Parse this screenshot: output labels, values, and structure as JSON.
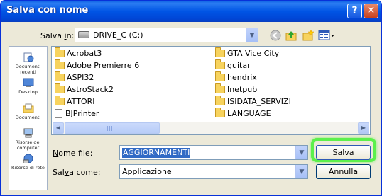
{
  "window": {
    "title": "Salva con nome"
  },
  "title_buttons": {
    "help": "?",
    "close": "✕"
  },
  "save_in": {
    "label": "Salva in:",
    "drive": "DRIVE_C (C:)"
  },
  "places": [
    {
      "label": "Documenti recenti",
      "icon": "recent-documents-icon"
    },
    {
      "label": "Desktop",
      "icon": "desktop-icon"
    },
    {
      "label": "Documenti",
      "icon": "documents-icon"
    },
    {
      "label": "Risorse del computer",
      "icon": "my-computer-icon"
    },
    {
      "label": "Risorse di rete",
      "icon": "network-icon"
    }
  ],
  "files": {
    "column1": [
      "Acrobat3",
      "Adobe Premierre 6",
      "ASPI32",
      "AstroStack2",
      "ATTORI",
      "BJPrinter"
    ],
    "column2": [
      "GTA Vice City",
      "guitar",
      "hendrix",
      "Inetpub",
      "ISIDATA_SERVIZI",
      "LANGUAGE"
    ]
  },
  "filename": {
    "label": "Nome file:",
    "value": "AGGIORNAMENTI"
  },
  "filetype": {
    "label": "Salva come:",
    "value": "Applicazione"
  },
  "buttons": {
    "save": "Salva",
    "cancel": "Annulla"
  },
  "colors": {
    "titlebar": "#0055e5",
    "highlight": "#316ac5",
    "save_button_glow": "#5cf04c"
  }
}
